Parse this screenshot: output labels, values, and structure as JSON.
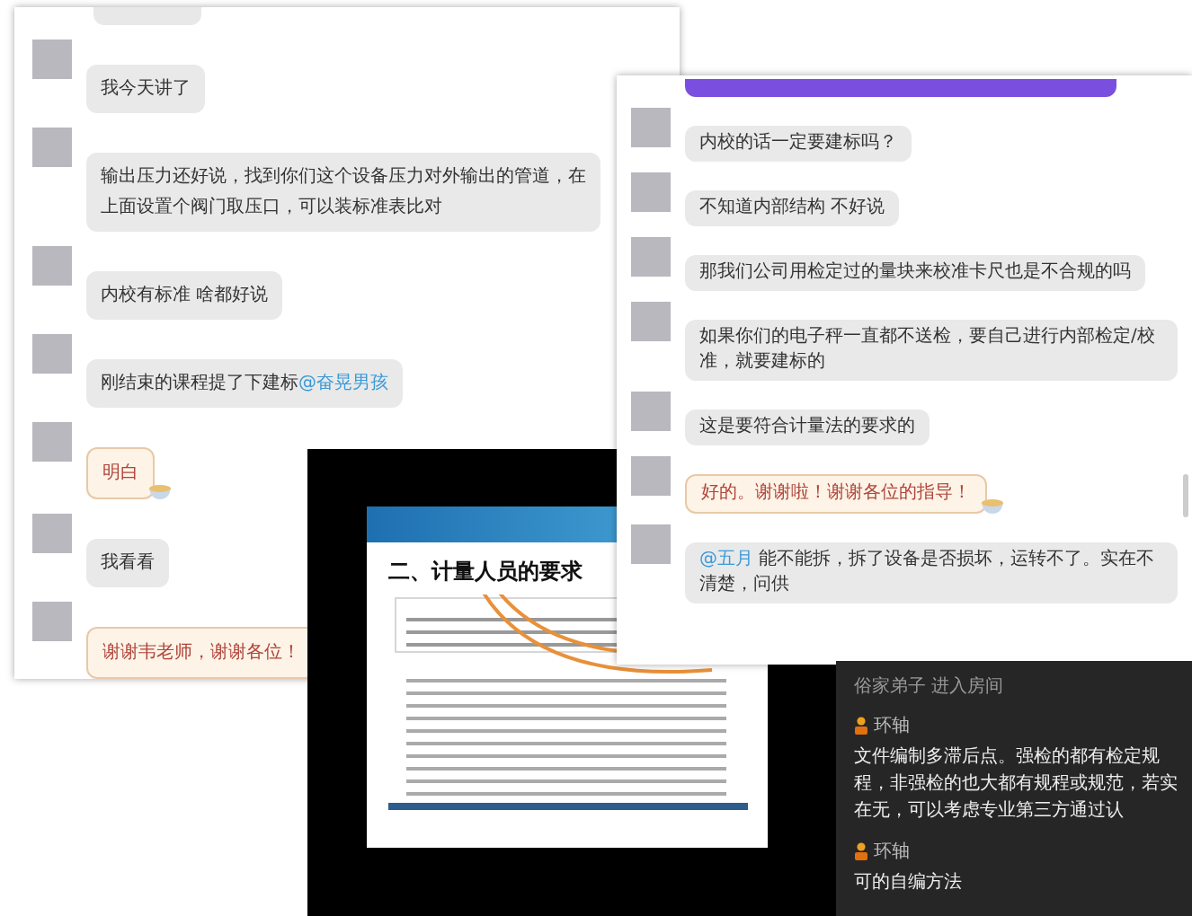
{
  "left_chat": {
    "messages": [
      {
        "kind": "cut"
      },
      {
        "kind": "plain",
        "parts": [
          {
            "text": "我今天讲了",
            "link": false
          }
        ]
      },
      {
        "kind": "plain",
        "parts": [
          {
            "text": "输出压力还好说，找到你们这个设备压力对外输出的管道，在上面设置个阀门取压口，可以装标准表比对",
            "link": false
          }
        ]
      },
      {
        "kind": "plain",
        "parts": [
          {
            "text": "内校有标准  啥都好说",
            "link": false
          }
        ]
      },
      {
        "kind": "plain",
        "parts": [
          {
            "text": "刚结束的课程提了下建标",
            "link": false
          },
          {
            "text": "@奋晃男孩",
            "link": true
          }
        ]
      },
      {
        "kind": "fancy",
        "parts": [
          {
            "text": "明白",
            "link": false
          }
        ]
      },
      {
        "kind": "plain",
        "parts": [
          {
            "text": "我看看",
            "link": false
          }
        ]
      },
      {
        "kind": "fancy",
        "parts": [
          {
            "text": "谢谢韦老师，谢谢各位！",
            "link": false
          }
        ]
      }
    ]
  },
  "slide": {
    "title": "二、计量人员的要求"
  },
  "right_chat": {
    "messages": [
      {
        "kind": "cut"
      },
      {
        "kind": "plain",
        "parts": [
          {
            "text": "内校的话一定要建标吗？",
            "link": false
          }
        ]
      },
      {
        "kind": "plain",
        "parts": [
          {
            "text": "不知道内部结构 不好说",
            "link": false
          }
        ]
      },
      {
        "kind": "plain",
        "parts": [
          {
            "text": "那我们公司用检定过的量块来校准卡尺也是不合规的吗",
            "link": false
          }
        ]
      },
      {
        "kind": "plain",
        "parts": [
          {
            "text": "如果你们的电子秤一直都不送检，要自己进行内部检定/校准，就要建标的",
            "link": false
          }
        ]
      },
      {
        "kind": "plain",
        "parts": [
          {
            "text": "这是要符合计量法的要求的",
            "link": false
          }
        ]
      },
      {
        "kind": "fancy",
        "parts": [
          {
            "text": "好的。谢谢啦！谢谢各位的指导！",
            "link": false
          }
        ]
      },
      {
        "kind": "plain",
        "parts": [
          {
            "text": "@五月",
            "link": true
          },
          {
            "text": " 能不能拆，拆了设备是否损坏，运转不了。实在不清楚，问供",
            "link": false
          }
        ]
      }
    ]
  },
  "live_chat": {
    "entries": [
      {
        "kind": "system",
        "text": "俗家弟子 进入房间"
      },
      {
        "kind": "user",
        "name": "环轴",
        "text": "文件编制多滞后点。强检的都有检定规程，非强检的也大都有规程或规范，若实在无，可以考虑专业第三方通过认"
      },
      {
        "kind": "user",
        "name": "环轴",
        "text": "可的自编方法"
      }
    ]
  }
}
